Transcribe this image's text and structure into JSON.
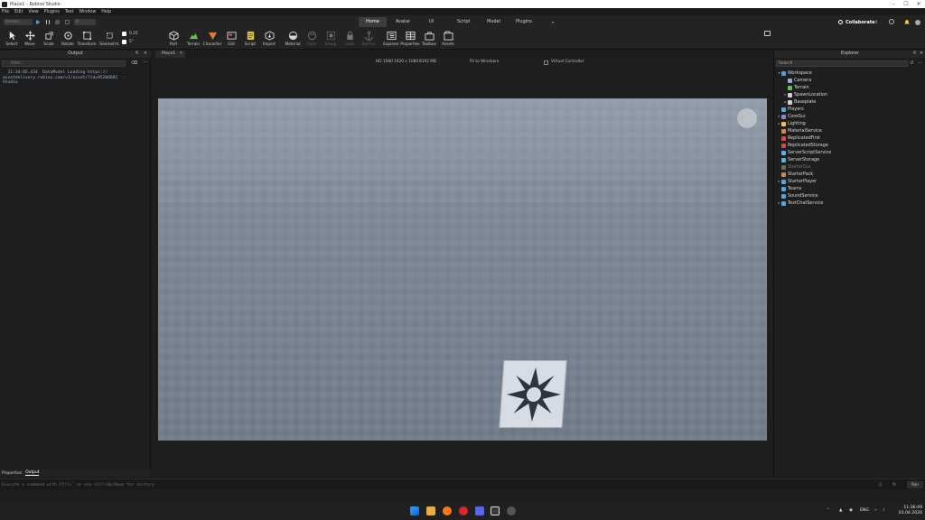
{
  "window": {
    "title": "Place1 - Roblox Studio"
  },
  "menu": [
    "File",
    "Edit",
    "View",
    "Plugins",
    "Test",
    "Window",
    "Help"
  ],
  "run": {
    "server_label": "Server...",
    "count": "0"
  },
  "ribbon_tabs": [
    {
      "label": "Home",
      "active": true
    },
    {
      "label": "Avatar"
    },
    {
      "label": "UI"
    },
    {
      "label": "Script"
    },
    {
      "label": "Model"
    },
    {
      "label": "Plugins"
    }
  ],
  "collaborate_label": "Collaborate",
  "snap": {
    "move": "0.25",
    "rotate": "5°"
  },
  "tools": [
    {
      "label": "Select"
    },
    {
      "label": "Move"
    },
    {
      "label": "Scale"
    },
    {
      "label": "Rotate"
    },
    {
      "label": "Transform"
    },
    {
      "label": "Geometric"
    },
    {
      "label": "Part"
    },
    {
      "label": "Terrain"
    },
    {
      "label": "Character"
    },
    {
      "label": "GUI"
    },
    {
      "label": "Script"
    },
    {
      "label": "Import"
    },
    {
      "label": "Material"
    },
    {
      "label": "Color"
    },
    {
      "label": "Group"
    },
    {
      "label": "Lock"
    },
    {
      "label": "Anchor"
    },
    {
      "label": "Explorer"
    },
    {
      "label": "Properties"
    },
    {
      "label": "Toolbox"
    },
    {
      "label": "Assets"
    }
  ],
  "output": {
    "title": "Output",
    "filter_placeholder": "Filter...",
    "log": "  11:34:05.434  DataModel Loading https://\nassetdelivery.roblox.com/v1/asset/?id=95206881  -\nStudio",
    "tabs": [
      "Properties",
      "Output"
    ]
  },
  "viewport": {
    "doc_tab": "Place1",
    "quality": "HD 1080",
    "resolution": "1920 x 1080",
    "memory": "8192 MB",
    "fit": "Fit to Window",
    "virtual_controller": "Virtual Controller"
  },
  "explorer": {
    "title": "Explorer",
    "search_placeholder": "Search",
    "nodes": [
      {
        "label": "Workspace",
        "depth": 0,
        "expanded": true,
        "color": "#4a9fe0"
      },
      {
        "label": "Camera",
        "depth": 1,
        "color": "#8ab4d9"
      },
      {
        "label": "Terrain",
        "depth": 1,
        "color": "#6bbf59"
      },
      {
        "label": "SpawnLocation",
        "depth": 1,
        "arrow": true,
        "color": "#d0d0d0"
      },
      {
        "label": "Baseplate",
        "depth": 1,
        "arrow": true,
        "color": "#d0d0d0"
      },
      {
        "label": "Players",
        "depth": 0,
        "color": "#5aa3e0"
      },
      {
        "label": "CoreGui",
        "depth": 0,
        "arrow": true,
        "color": "#9a7fd1"
      },
      {
        "label": "Lighting",
        "depth": 0,
        "arrow": true,
        "color": "#f0c24b"
      },
      {
        "label": "MaterialService",
        "depth": 0,
        "color": "#c98b4a"
      },
      {
        "label": "ReplicatedFirst",
        "depth": 0,
        "color": "#d24a4a"
      },
      {
        "label": "ReplicatedStorage",
        "depth": 0,
        "color": "#d24a4a"
      },
      {
        "label": "ServerScriptService",
        "depth": 0,
        "color": "#5ab0e8"
      },
      {
        "label": "ServerStorage",
        "depth": 0,
        "color": "#5ab0e8"
      },
      {
        "label": "StarterGui",
        "depth": 0,
        "dim": true,
        "color": "#6a6a6a"
      },
      {
        "label": "StarterPack",
        "depth": 0,
        "color": "#c98b4a"
      },
      {
        "label": "StarterPlayer",
        "depth": 0,
        "arrow": true,
        "color": "#5aa3e0"
      },
      {
        "label": "Teams",
        "depth": 0,
        "color": "#5aa3e0"
      },
      {
        "label": "SoundService",
        "depth": 0,
        "color": "#5aa3e0"
      },
      {
        "label": "TextChatService",
        "depth": 0,
        "arrow": true,
        "color": "#5aa3e0"
      }
    ]
  },
  "command": {
    "placeholder": "Execute a command with Ctrl+` or use Ctrl+Up/Down for history",
    "run_label": "Run"
  },
  "taskbar": {
    "lang": "ENG",
    "time": "11:36:49",
    "date": "03.04.2026"
  }
}
